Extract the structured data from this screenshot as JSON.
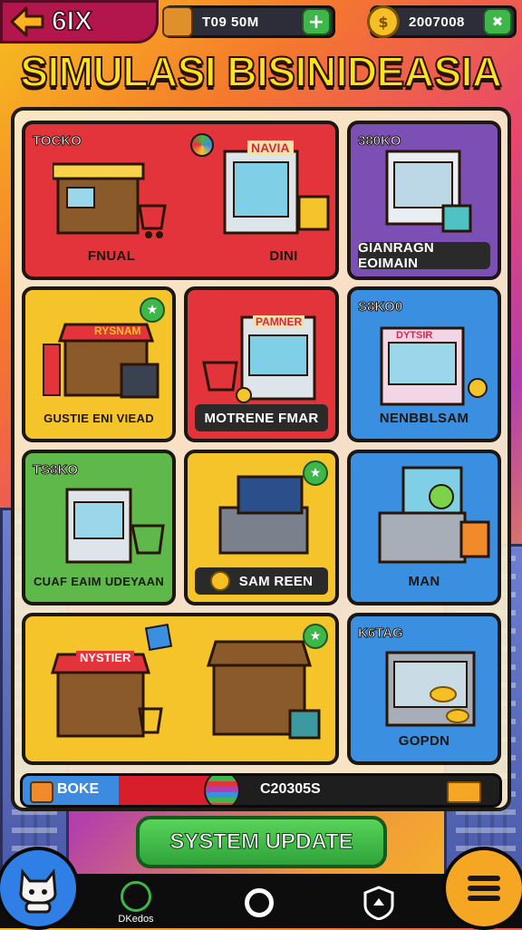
{
  "header": {
    "level": "6IX",
    "resource_1": "T09 50M",
    "resource_2": "2007008",
    "plus_label": "+",
    "close_label": "✖"
  },
  "title": "SIMULASI BISINIDEASIA",
  "cards": [
    {
      "tag": "TOCKO",
      "label_left": "FNUAL",
      "label_right": "DINI"
    },
    {
      "tag": "380KO",
      "label": "GIANRAGN EOIMAIN"
    },
    {
      "tag": "",
      "label": "GUSTIE ENI VIEAD"
    },
    {
      "tag": "",
      "label": "MOTRENE FMAR"
    },
    {
      "tag": "S8KO0",
      "label": "NENBBLSAM"
    },
    {
      "tag": "TS8KO",
      "label": "CUAF EAIM UDEYAAN"
    },
    {
      "tag": "",
      "label": "SAM REEN"
    },
    {
      "tag": "",
      "label": "MAN"
    },
    {
      "tag": "",
      "label": ""
    },
    {
      "tag": "K6TAG",
      "label": "GOPDN"
    }
  ],
  "signs": {
    "kiosk_top": "NAVIA",
    "kiosk_b": "RYSNAM",
    "kiosk_c": "PAMNER",
    "kiosk_d": "DYTSIR",
    "kiosk_wide": "NYSTIER"
  },
  "progress": {
    "left_text": "BOKE",
    "right_text": "C20305S",
    "blue_fraction": 0.2,
    "red_fraction": 0.22
  },
  "update_button": "SYSTEM UPDATE",
  "nav": {
    "item_2_label": "DKedos"
  },
  "colors": {
    "red": "#e3343c",
    "purple": "#7b4fb3",
    "yellow": "#f5c42a",
    "blue": "#3b8fe0",
    "green": "#5fb84a",
    "nav_blue": "#2f7fe6",
    "nav_orange": "#f5a623"
  }
}
